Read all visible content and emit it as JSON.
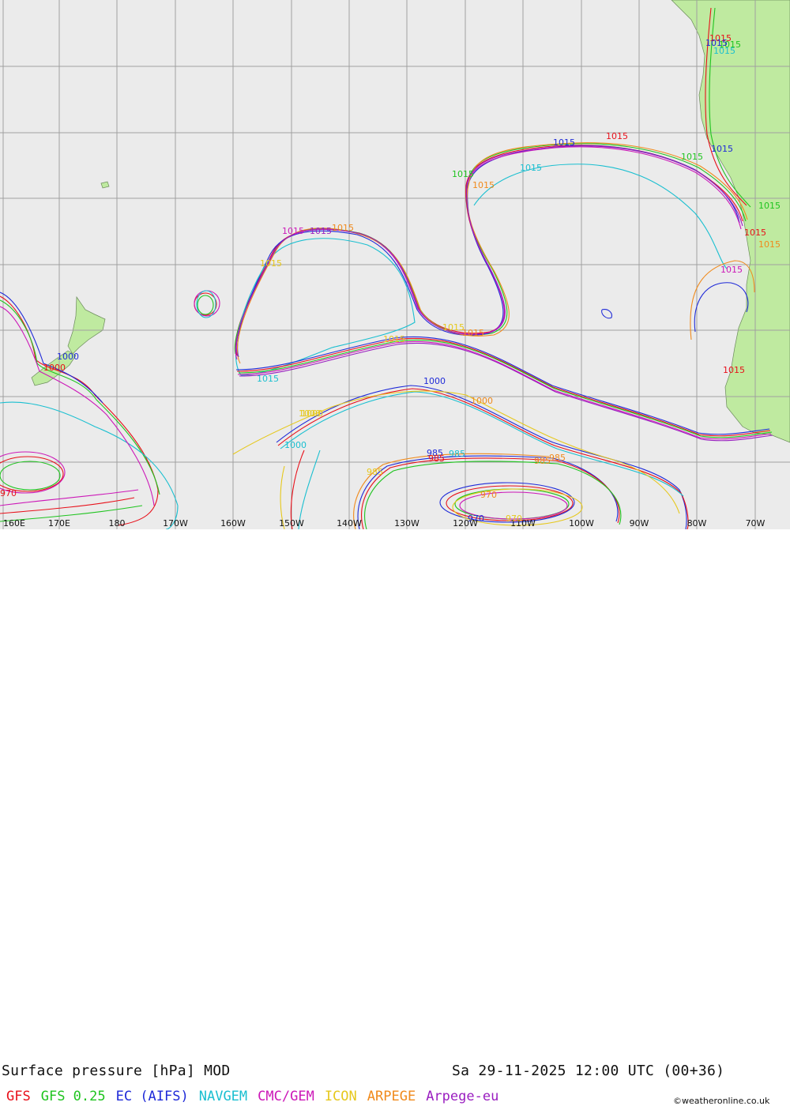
{
  "title": {
    "left": "Surface pressure [hPa] MOD",
    "right": "Sa 29-11-2025 12:00 UTC (00+36)"
  },
  "axis": {
    "x_ticks": [
      "160E",
      "170E",
      "180",
      "170W",
      "160W",
      "150W",
      "140W",
      "130W",
      "120W",
      "110W",
      "100W",
      "90W",
      "80W",
      "70W"
    ]
  },
  "legend": [
    {
      "name": "GFS",
      "color": "#e8101a"
    },
    {
      "name": "GFS 0.25",
      "color": "#1fc41f"
    },
    {
      "name": "EC (AIFS)",
      "color": "#1f2ad8"
    },
    {
      "name": "NAVGEM",
      "color": "#19bfd0"
    },
    {
      "name": "CMC/GEM",
      "color": "#cc18b8"
    },
    {
      "name": "ICON",
      "color": "#e6c81c"
    },
    {
      "name": "ARPEGE",
      "color": "#f08a1c"
    },
    {
      "name": "Arpege-eu",
      "color": "#9a1ec0"
    }
  ],
  "isobar_labels": [
    {
      "text": "1015",
      "color": "#e8101a"
    },
    {
      "text": "1015",
      "color": "#1fc41f"
    },
    {
      "text": "1015",
      "color": "#1f2ad8"
    },
    {
      "text": "1015",
      "color": "#19bfd0"
    },
    {
      "text": "1015",
      "color": "#cc18b8"
    },
    {
      "text": "1015",
      "color": "#e6c81c"
    },
    {
      "text": "1015",
      "color": "#f08a1c"
    },
    {
      "text": "1015",
      "color": "#9a1ec0"
    },
    {
      "text": "1015",
      "color": "#e8101a"
    },
    {
      "text": "1015",
      "color": "#1fc41f"
    },
    {
      "text": "1015",
      "color": "#1f2ad8"
    },
    {
      "text": "1015",
      "color": "#19bfd0"
    },
    {
      "text": "1015",
      "color": "#f08a1c"
    },
    {
      "text": "1015",
      "color": "#e6c81c"
    },
    {
      "text": "1015",
      "color": "#1fc41f"
    },
    {
      "text": "1015",
      "color": "#f08a1c"
    },
    {
      "text": "1015",
      "color": "#1f2ad8"
    },
    {
      "text": "1015",
      "color": "#e8101a"
    },
    {
      "text": "1015",
      "color": "#cc18b8"
    },
    {
      "text": "1015",
      "color": "#f08a1c"
    },
    {
      "text": "1015",
      "color": "#1fc41f"
    },
    {
      "text": "1015",
      "color": "#e8101a"
    },
    {
      "text": "1015",
      "color": "#19bfd0"
    },
    {
      "text": "1015",
      "color": "#e6c81c"
    },
    {
      "text": "1000",
      "color": "#1f2ad8"
    },
    {
      "text": "1000",
      "color": "#e8101a"
    },
    {
      "text": "1000",
      "color": "#19bfd0"
    },
    {
      "text": "1000",
      "color": "#e6c81c"
    },
    {
      "text": "1000",
      "color": "#1f2ad8"
    },
    {
      "text": "1000",
      "color": "#e6c81c"
    },
    {
      "text": "1000",
      "color": "#f08a1c"
    },
    {
      "text": "985",
      "color": "#1f2ad8"
    },
    {
      "text": "985",
      "color": "#e8101a"
    },
    {
      "text": "985",
      "color": "#19bfd0"
    },
    {
      "text": "985",
      "color": "#f08a1c"
    },
    {
      "text": "985",
      "color": "#f08a1c"
    },
    {
      "text": "985",
      "color": "#e6c81c"
    },
    {
      "text": "970",
      "color": "#e8101a"
    },
    {
      "text": "970",
      "color": "#1f2ad8"
    },
    {
      "text": "970",
      "color": "#f08a1c"
    },
    {
      "text": "970",
      "color": "#e6c81c"
    }
  ],
  "credit": "©weatheronline.co.uk"
}
